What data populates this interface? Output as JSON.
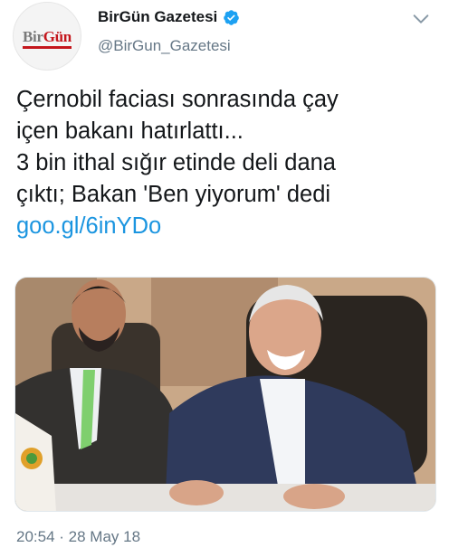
{
  "header": {
    "display_name": "BirGün Gazetesi",
    "handle": "@BirGun_Gazetesi",
    "avatar_logo": {
      "part1": "Bir",
      "part2": "Gün"
    },
    "verified": true,
    "verified_icon": "verified-badge-icon",
    "menu_icon": "chevron-down-icon"
  },
  "tweet": {
    "lines": [
      "Çernobil faciası sonrasında çay",
      "içen bakanı hatırlattı...",
      "3 bin ithal sığır etinde deli dana",
      "çıktı; Bakan 'Ben yiyorum' dedi"
    ],
    "link": "goo.gl/6inYDo"
  },
  "media": {
    "type": "photo"
  },
  "meta": {
    "timestamp": "20:54 · 28 May 18"
  },
  "colors": {
    "link": "#1b95e0",
    "secondary_text": "#657786",
    "primary_text": "#14171a",
    "brand_red": "#c4161c",
    "verified_blue": "#1da1f2"
  }
}
